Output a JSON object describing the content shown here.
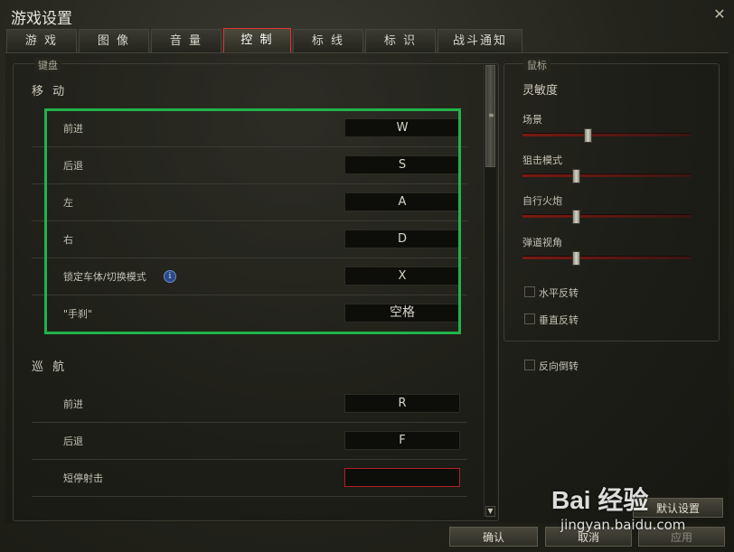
{
  "window": {
    "title": "游戏设置",
    "close_glyph": "✕"
  },
  "tabs": [
    {
      "label": "游 戏"
    },
    {
      "label": "图 像"
    },
    {
      "label": "音 量"
    },
    {
      "label": "控 制",
      "active": true
    },
    {
      "label": "标 线"
    },
    {
      "label": "标 识"
    },
    {
      "label": "战斗通知"
    }
  ],
  "keyboard": {
    "legend": "键盘",
    "move": {
      "title": "移 动",
      "rows": [
        {
          "label": "前进",
          "key": "W"
        },
        {
          "label": "后退",
          "key": "S"
        },
        {
          "label": "左",
          "key": "A"
        },
        {
          "label": "右",
          "key": "D"
        },
        {
          "label": "锁定车体/切换模式",
          "key": "X",
          "info": "i"
        },
        {
          "label": "\"手刹\"",
          "key": "空格"
        }
      ]
    },
    "cruise": {
      "title": "巡 航",
      "rows": [
        {
          "label": "前进",
          "key": "R"
        },
        {
          "label": "后退",
          "key": "F"
        },
        {
          "label": "短停射击",
          "key": ""
        }
      ]
    },
    "scroll_grip": "≡",
    "scroll_down": "▼"
  },
  "mouse": {
    "legend": "鼠标",
    "sensitivity": "灵敏度",
    "sliders": [
      {
        "label": "场景",
        "value": 0.38
      },
      {
        "label": "狙击模式",
        "value": 0.31
      },
      {
        "label": "自行火炮",
        "value": 0.31
      },
      {
        "label": "弹道视角",
        "value": 0.31
      }
    ],
    "checkboxes": [
      {
        "label": "水平反转",
        "checked": false
      },
      {
        "label": "垂直反转",
        "checked": false
      }
    ]
  },
  "reverse_turn": {
    "label": "反向倒转",
    "checked": false
  },
  "buttons": {
    "default_label": "默认设置",
    "ok_label": "确认",
    "cancel_label": "取消",
    "apply_label": "应用"
  },
  "watermark": {
    "brand": "Bai 经验",
    "url": "jingyan.baidu.com"
  }
}
